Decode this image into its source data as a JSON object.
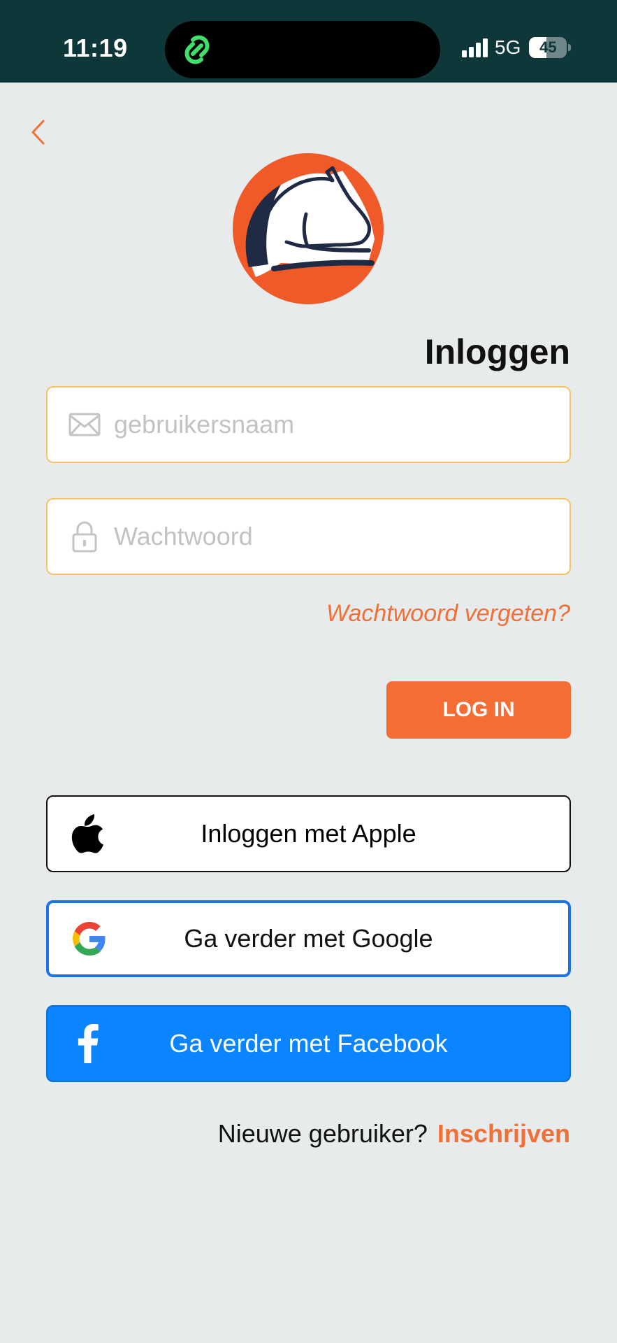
{
  "status_bar": {
    "time": "11:19",
    "network": "5G",
    "battery_level": "45",
    "battery_fraction": 0.45
  },
  "icons": {
    "back": "chevron-left-icon",
    "island_app": "link-icon",
    "signal": "signal-bars-icon",
    "email": "envelope-icon",
    "password": "lock-icon",
    "apple": "apple-icon",
    "google": "google-icon",
    "facebook": "facebook-icon",
    "logo": "horse-logo"
  },
  "colors": {
    "accent": "#f56c35",
    "status_bar": "#0e3739",
    "background": "#e8ebec",
    "input_border": "#f5c26b",
    "google_blue": "#1a73e8",
    "facebook_blue": "#0a84ff"
  },
  "login": {
    "title": "Inloggen",
    "username_placeholder": "gebruikersnaam",
    "username_value": "",
    "password_placeholder": "Wachtwoord",
    "password_value": "",
    "forgot_password": "Wachtwoord vergeten?",
    "login_button": "LOG IN"
  },
  "social": {
    "apple": "Inloggen met Apple",
    "google": "Ga verder met Google",
    "facebook": "Ga verder met Facebook"
  },
  "signup": {
    "question": "Nieuwe gebruiker?",
    "link": "Inschrijven"
  }
}
